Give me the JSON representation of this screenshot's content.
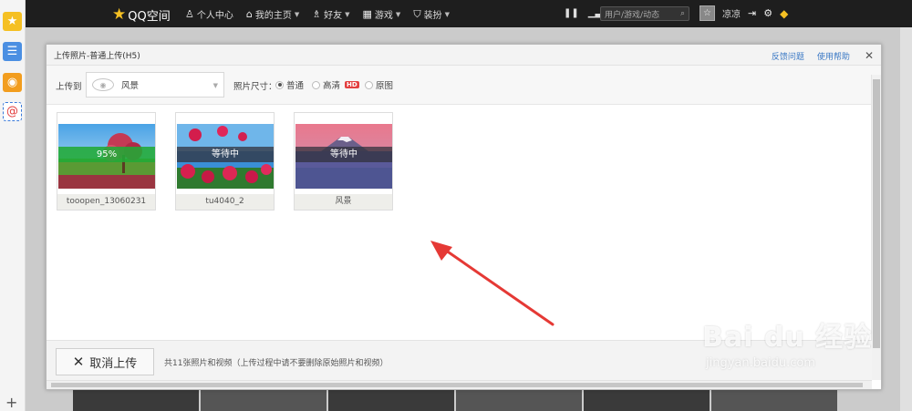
{
  "topbar": {
    "logo": "QQ空间",
    "nav": [
      {
        "icon": "person-icon",
        "glyph": "♙",
        "label": "个人中心",
        "caret": false
      },
      {
        "icon": "home-icon",
        "glyph": "⌂",
        "label": "我的主页",
        "caret": true
      },
      {
        "icon": "friends-icon",
        "glyph": "♗",
        "label": "好友",
        "caret": true
      },
      {
        "icon": "games-icon",
        "glyph": "▦",
        "label": "游戏",
        "caret": true
      },
      {
        "icon": "shirt-icon",
        "glyph": "⛉",
        "label": "装扮",
        "caret": true
      }
    ],
    "search_placeholder": "用户/游戏/动态",
    "username": "凉凉"
  },
  "dialog": {
    "title": "上传照片-普通上传(H5)",
    "link_feedback": "反馈问题",
    "link_help": "使用帮助",
    "upload_to_label": "上传到",
    "album": "风景",
    "size_label": "照片尺寸：",
    "sizes": [
      {
        "label": "普通",
        "selected": true
      },
      {
        "label": "高清",
        "selected": false,
        "badge": "HD"
      },
      {
        "label": "原图",
        "selected": false
      }
    ],
    "photos": [
      {
        "name": "tooopen_13060231",
        "status": "95%",
        "progress": 0.95
      },
      {
        "name": "tu4040_2",
        "status": "等待中"
      },
      {
        "name": "风景",
        "status": "等待中"
      }
    ],
    "cancel_label": "取消上传",
    "footer_text": "共11张照片和视频（上传过程中请不要删除原始照片和视频）"
  },
  "watermark": {
    "main": "Bai du 经验",
    "sub": "jingyan.baidu.com"
  },
  "colors": {
    "topbar": "#1e1e1e",
    "progress": "#21aa37",
    "link": "#3b79c5",
    "arrow": "#e53935"
  }
}
